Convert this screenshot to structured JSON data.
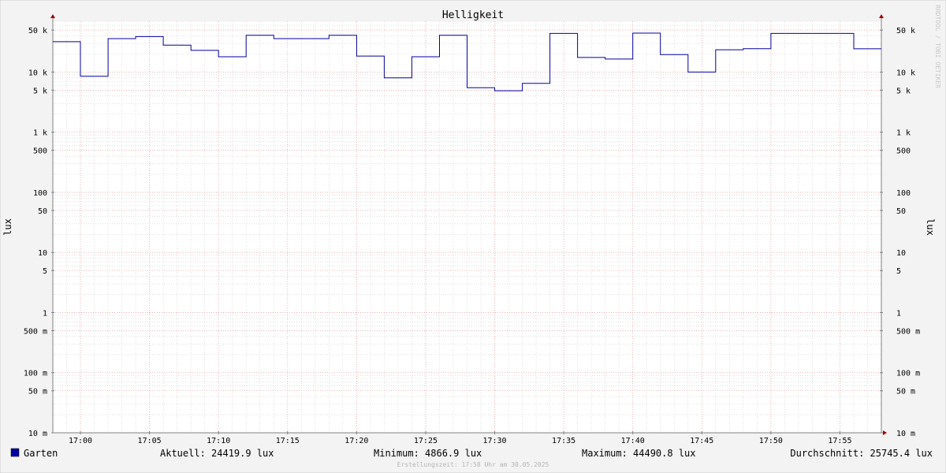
{
  "colors": {
    "background": "#f3f3f3",
    "canvas": "#ffffff",
    "grid_major": "#e8a0a0",
    "grid_minor": "#cccccc",
    "series": "#0000a0",
    "axis": "#808080",
    "arrow": "#a00000",
    "text": "#000000",
    "watermark": "#c8c8c8"
  },
  "chart_data": {
    "type": "line",
    "step": true,
    "title": "Helligkeit",
    "ylabel": "lux",
    "ylabel_right": "lux",
    "yscale": "log",
    "ylim": [
      0.01,
      70000
    ],
    "xlim": [
      "16:58",
      "17:58"
    ],
    "grid": true,
    "legend_position": "bottom-left",
    "x_ticks": [
      "17:00",
      "17:05",
      "17:10",
      "17:15",
      "17:20",
      "17:25",
      "17:30",
      "17:35",
      "17:40",
      "17:45",
      "17:50",
      "17:55"
    ],
    "y_ticks": [
      {
        "value": 50000,
        "label": "50 k"
      },
      {
        "value": 10000,
        "label": "10 k"
      },
      {
        "value": 5000,
        "label": "5 k"
      },
      {
        "value": 1000,
        "label": "1 k"
      },
      {
        "value": 500,
        "label": "500"
      },
      {
        "value": 100,
        "label": "100"
      },
      {
        "value": 50,
        "label": "50"
      },
      {
        "value": 10,
        "label": "10"
      },
      {
        "value": 5,
        "label": "5"
      },
      {
        "value": 1,
        "label": "1"
      },
      {
        "value": 0.5,
        "label": "500 m"
      },
      {
        "value": 0.1,
        "label": "100 m"
      },
      {
        "value": 0.05,
        "label": "50 m"
      },
      {
        "value": 0.01,
        "label": "10 m"
      }
    ],
    "series": [
      {
        "name": "Garten",
        "x": [
          "16:58",
          "17:00",
          "17:02",
          "17:04",
          "17:06",
          "17:08",
          "17:10",
          "17:12",
          "17:14",
          "17:16",
          "17:18",
          "17:20",
          "17:22",
          "17:24",
          "17:26",
          "17:28",
          "17:30",
          "17:32",
          "17:34",
          "17:36",
          "17:38",
          "17:40",
          "17:42",
          "17:44",
          "17:46",
          "17:48",
          "17:50",
          "17:52",
          "17:54",
          "17:56",
          "17:58"
        ],
        "values": [
          32000,
          8500,
          36000,
          39000,
          28000,
          23000,
          18000,
          41000,
          36000,
          36000,
          41000,
          18500,
          8000,
          18000,
          41000,
          5500,
          4900,
          6500,
          44000,
          17500,
          16500,
          44500,
          19500,
          10000,
          23500,
          24500,
          44000,
          44000,
          44000,
          24400,
          24400
        ]
      }
    ],
    "legend": {
      "name": "Garten"
    },
    "stats": {
      "current": "Aktuell: 24419.9 lux",
      "minimum": "Minimum: 4866.9 lux",
      "maximum": "Maximum: 44490.8 lux",
      "average": "Durchschnitt: 25745.4 lux"
    },
    "footer": "Erstellungszeit: 17:58 Uhr am 30.05.2025",
    "watermark": "RRDTOOL / TOBI OETIKER"
  }
}
